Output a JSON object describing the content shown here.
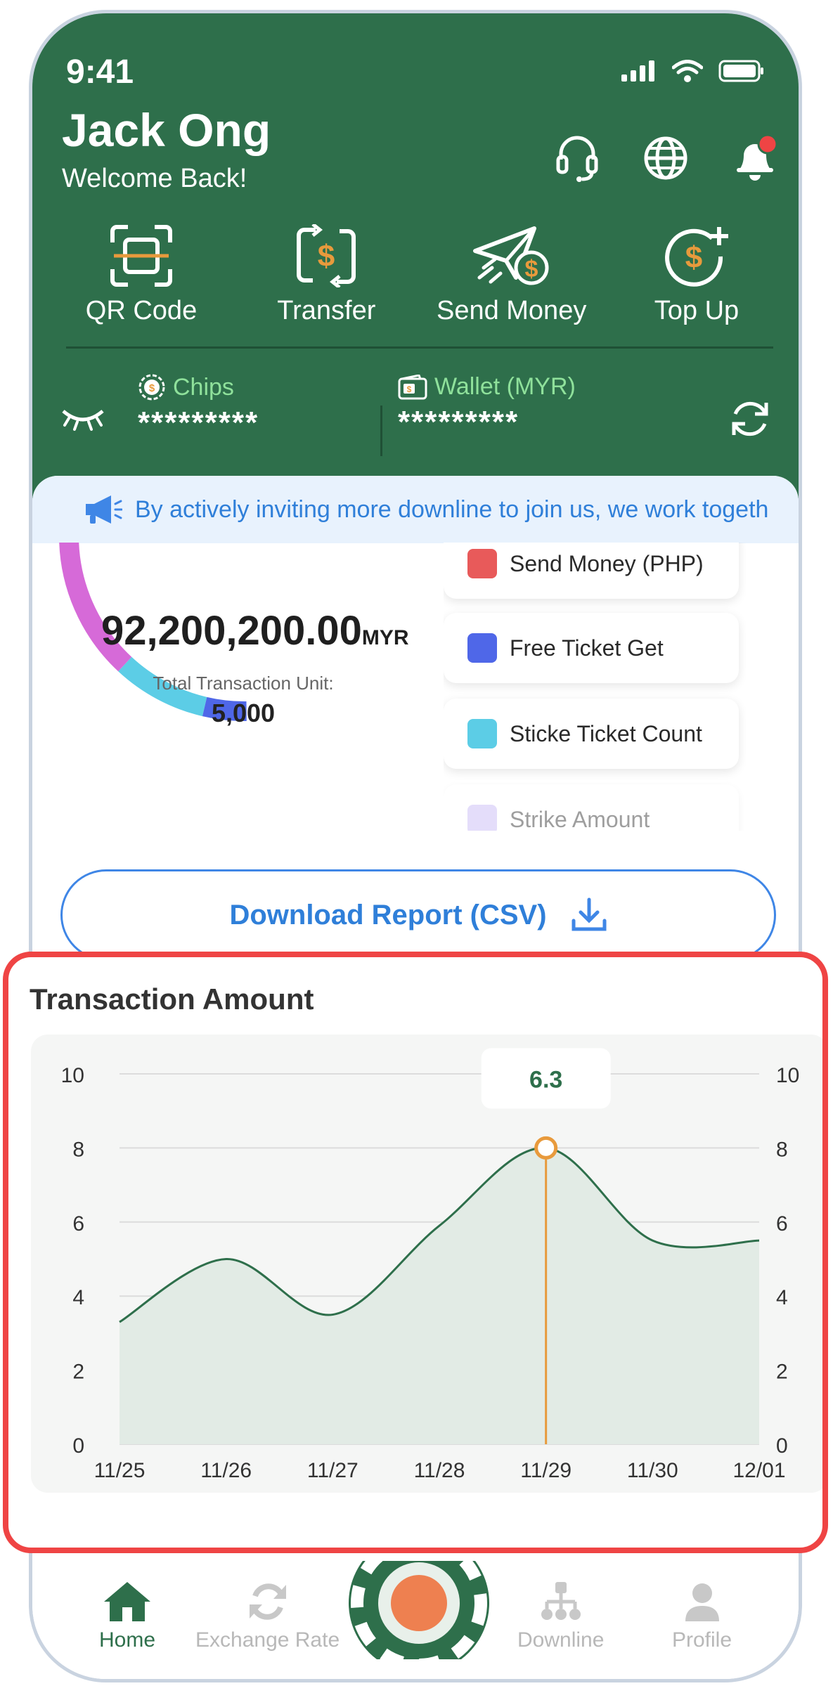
{
  "status_bar": {
    "time": "9:41"
  },
  "header": {
    "user_name": "Jack Ong",
    "welcome": "Welcome Back!",
    "icons": [
      "headset-icon",
      "globe-icon",
      "bell-icon"
    ]
  },
  "quick_actions": [
    {
      "label": "QR Code",
      "icon": "qr-scan-icon"
    },
    {
      "label": "Transfer",
      "icon": "transfer-icon"
    },
    {
      "label": "Send Money",
      "icon": "send-money-icon"
    },
    {
      "label": "Top Up",
      "icon": "top-up-icon"
    }
  ],
  "balances": {
    "chips_label": "Chips",
    "chips_value": "*********",
    "wallet_label": "Wallet (MYR)",
    "wallet_value": "*********"
  },
  "announcement": {
    "text": "By actively inviting more downline to join us, we work togeth"
  },
  "summary": {
    "amount": "92,200,200.00",
    "currency": "MYR",
    "unit_label": "Total Transaction Unit:",
    "unit_value": "5,000"
  },
  "legend": [
    {
      "label": "Send Money (PHP)",
      "color": "#e85a5a"
    },
    {
      "label": "Free Ticket Get",
      "color": "#4f67e8"
    },
    {
      "label": "Sticke Ticket Count",
      "color": "#5ccde6"
    },
    {
      "label": "Strike Amount",
      "color": "#c5b4f5"
    }
  ],
  "download": {
    "label": "Download Report (CSV)"
  },
  "chart_data": {
    "type": "area",
    "title": "Transaction Amount",
    "categories": [
      "11/25",
      "11/26",
      "11/27",
      "11/28",
      "11/29",
      "11/30",
      "12/01"
    ],
    "values": [
      3.3,
      5.0,
      3.5,
      5.9,
      8.0,
      5.5,
      5.5
    ],
    "ylim": [
      0,
      10
    ],
    "yticks": [
      0,
      2,
      4,
      6,
      8,
      10
    ],
    "grid": true,
    "line_color": "#2e6f4b",
    "fill_color": "#e2ebe5",
    "highlight": {
      "category": "11/29",
      "tooltip": "6.3",
      "color": "#e89a3c"
    }
  },
  "tabbar": [
    {
      "label": "Home",
      "icon": "home-icon",
      "active": true
    },
    {
      "label": "Exchange Rate",
      "icon": "exchange-icon",
      "active": false
    },
    {
      "label": "",
      "icon": "casino-chip-icon",
      "active": false
    },
    {
      "label": "Downline",
      "icon": "downline-icon",
      "active": false
    },
    {
      "label": "Profile",
      "icon": "profile-icon",
      "active": false
    }
  ]
}
